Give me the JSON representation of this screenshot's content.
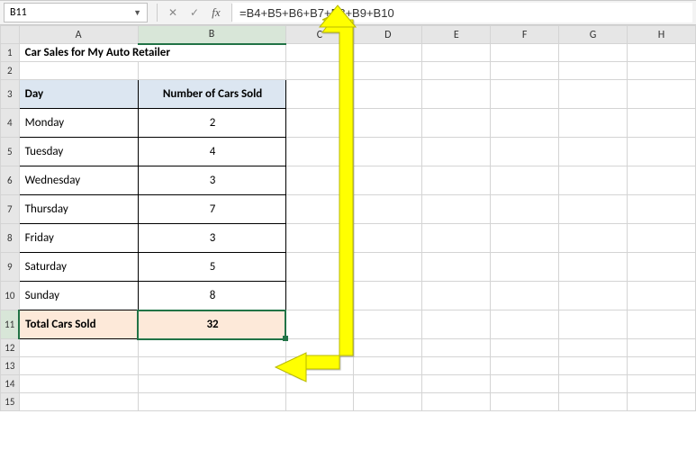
{
  "namebox": {
    "value": "B11"
  },
  "formula_bar": {
    "formula": "=B4+B5+B6+B7+B8+B9+B10"
  },
  "columns": [
    "A",
    "B",
    "C",
    "D",
    "E",
    "F",
    "G",
    "H"
  ],
  "title": "Car Sales for My Auto Retailer",
  "table": {
    "headers": {
      "day": "Day",
      "count": "Number of Cars Sold"
    },
    "rows": [
      {
        "day": "Monday",
        "count": "2"
      },
      {
        "day": "Tuesday",
        "count": "4"
      },
      {
        "day": "Wednesday",
        "count": "3"
      },
      {
        "day": "Thursday",
        "count": "7"
      },
      {
        "day": "Friday",
        "count": "3"
      },
      {
        "day": "Saturday",
        "count": "5"
      },
      {
        "day": "Sunday",
        "count": "8"
      }
    ],
    "total": {
      "label": "Total Cars Sold",
      "value": "32"
    }
  },
  "chart_data": {
    "type": "table",
    "title": "Car Sales for My Auto Retailer",
    "categories": [
      "Monday",
      "Tuesday",
      "Wednesday",
      "Thursday",
      "Friday",
      "Saturday",
      "Sunday"
    ],
    "values": [
      2,
      4,
      3,
      7,
      3,
      5,
      8
    ],
    "total": 32,
    "xlabel": "Day",
    "ylabel": "Number of Cars Sold"
  }
}
